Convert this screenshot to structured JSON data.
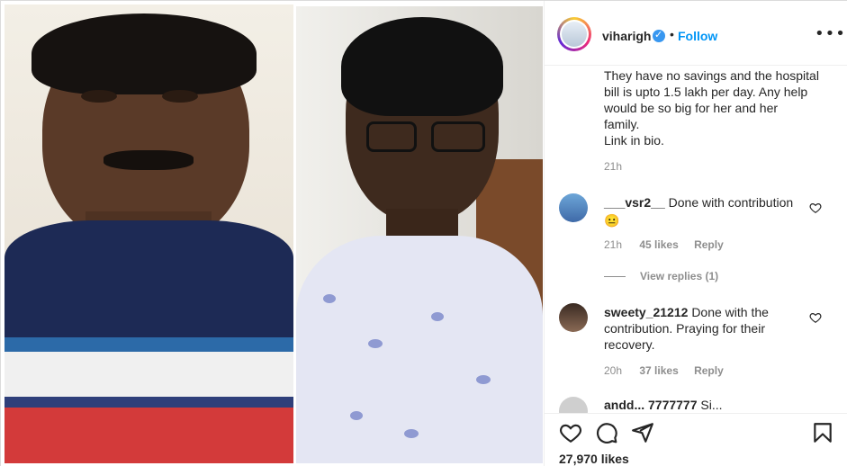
{
  "post": {
    "username": "viharigh",
    "follow_label": "Follow",
    "more_label": "•••",
    "separator": "•",
    "caption_lines": [
      "They have no savings and the hospital",
      "bill is upto 1.5 lakh per day. Any help",
      "would be so big for her and her",
      "family.",
      "Link in bio."
    ],
    "caption_time": "21h",
    "likes": "27,970 likes"
  },
  "comments": [
    {
      "user": "___vsr2__",
      "text": "Done with contribution",
      "emoji": "😐",
      "time": "21h",
      "likes": "45 likes",
      "reply": "Reply",
      "view_replies": "View replies (1)"
    },
    {
      "user": "sweety_21212",
      "text": "Done with the contribution. Praying for their recovery.",
      "time": "20h",
      "likes": "37 likes",
      "reply": "Reply"
    },
    {
      "user": "andd... 7777777",
      "text": "Si..."
    }
  ],
  "icons": [
    "heart-icon",
    "comment-icon",
    "share-icon",
    "bookmark-icon",
    "verified-icon",
    "more-icon"
  ],
  "colors": {
    "follow": "#0095f6",
    "verified": "#3897f0",
    "muted": "#8e8e8e"
  }
}
